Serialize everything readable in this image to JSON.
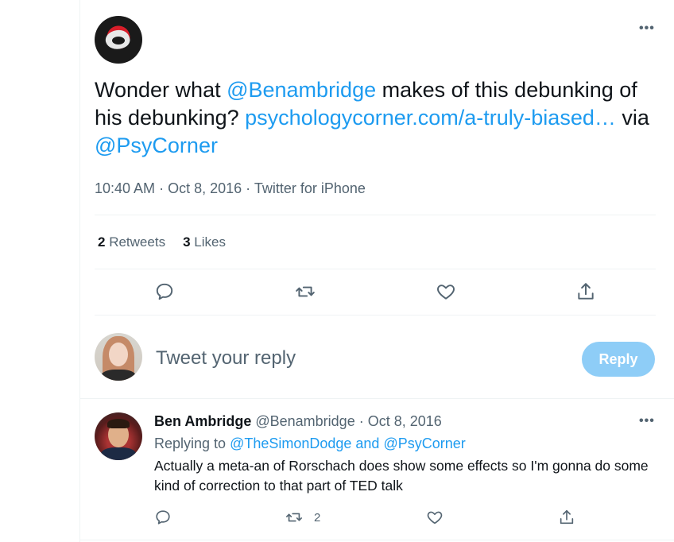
{
  "main_tweet": {
    "text_before": "Wonder what ",
    "mention": "@Benambridge",
    "text_middle": " makes of this debunking of his debunking? ",
    "link": "psychologycorner.com/a-truly-biased…",
    "text_via": " via ",
    "via_handle": "@PsyCorner",
    "time": "10:40 AM",
    "date": "Oct 8, 2016",
    "source": "Twitter for iPhone",
    "retweets_count": "2",
    "retweets_label": "Retweets",
    "likes_count": "3",
    "likes_label": "Likes",
    "more_label": "•••"
  },
  "compose": {
    "placeholder": "Tweet your reply",
    "reply_button": "Reply"
  },
  "reply_tweet": {
    "name": "Ben Ambridge",
    "handle": "@Benambridge",
    "date": "Oct 8, 2016",
    "replying_prefix": "Replying to ",
    "replying_to": "@TheSimonDodge and @PsyCorner",
    "text": "Actually a meta-an of Rorschach does show some effects so I'm gonna do some kind of correction to that part of TED talk",
    "retweet_count": "2",
    "more_label": "•••"
  },
  "colors": {
    "accent": "#1d9bf0",
    "muted": "#536471",
    "reply_button_disabled": "#8ecdf7"
  },
  "icons": [
    "reply-icon",
    "retweet-icon",
    "like-icon",
    "share-icon"
  ]
}
